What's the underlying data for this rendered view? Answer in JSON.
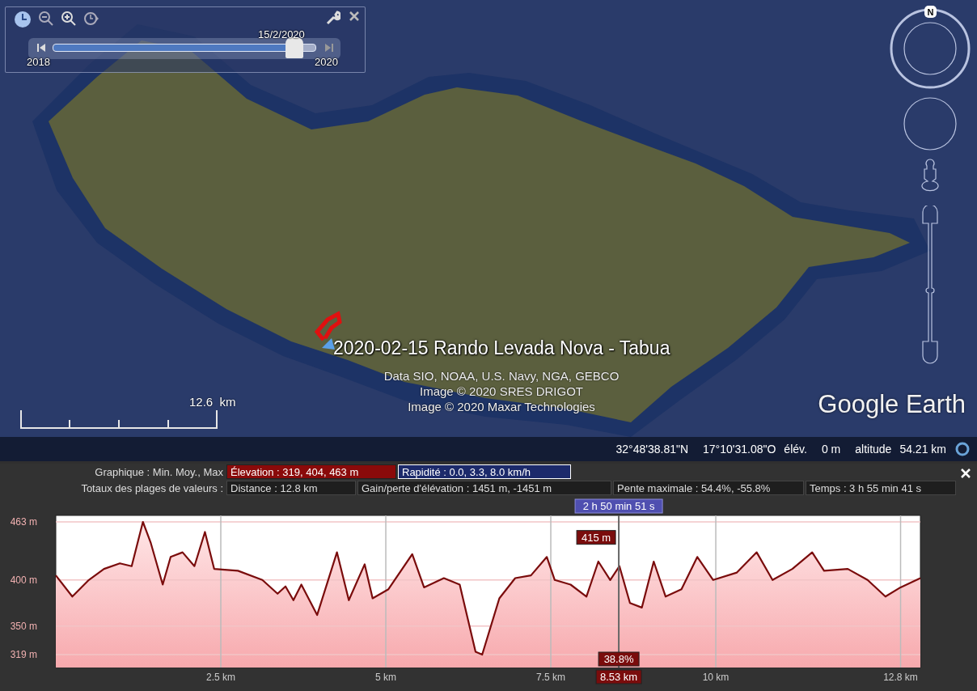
{
  "time_slider": {
    "date_label": "15/2/2020",
    "start_label": "2018",
    "end_label": "2020",
    "level": 0.95
  },
  "compass": {
    "north_label": "N"
  },
  "track_label": "2020-02-15 Rando Levada Nova - Tabua",
  "credits": [
    "Data SIO, NOAA, U.S. Navy, NGA, GEBCO",
    "Image © 2020 SRES DRIGOT",
    "Image © 2020 Maxar Technologies"
  ],
  "scale": {
    "value": "12.6",
    "unit": "km"
  },
  "logo": "Google Earth",
  "status_bar": {
    "latitude": "32°48'38.81\"N",
    "longitude": "17°10'31.08\"O",
    "elevation_label": "élév.",
    "elevation": "0 m",
    "altitude_label": "altitude",
    "altitude": "54.21 km"
  },
  "profile": {
    "graph_label": "Graphique : Min. Moy., Max",
    "graph_series": [
      {
        "label": "Élevation : 319, 404, 463 m",
        "color": "#8a0a0a"
      },
      {
        "label": "Rapidité : 0.0, 3.3, 8.0 km/h",
        "color": "#1c2a6b"
      }
    ],
    "totals_label": "Totaux des plages de valeurs :",
    "totals": [
      "Distance : 12.8 km",
      "Gain/perte d'élévation : 1451 m, -1451 m",
      "Pente maximale : 54.4%, -55.8%",
      "Temps : 3 h 55 min 41 s"
    ],
    "cursor": {
      "time": "2 h 50 min 51 s",
      "elevation": "415 m",
      "slope": "38.8%",
      "distance": "8.53 km"
    },
    "chart_data": {
      "type": "area",
      "grid": true,
      "xlim": [
        0,
        13.1
      ],
      "ylim": [
        305,
        470
      ],
      "xticks": [
        {
          "value": 2.5,
          "label": "2.5 km"
        },
        {
          "value": 5,
          "label": "5 km"
        },
        {
          "value": 7.5,
          "label": "7.5 km"
        },
        {
          "value": 10,
          "label": "10 km"
        },
        {
          "value": 12.8,
          "label": "12.8 km"
        }
      ],
      "yticks": [
        {
          "value": 463,
          "label": "463 m"
        },
        {
          "value": 400,
          "label": "400 m"
        },
        {
          "value": 350,
          "label": "350 m"
        },
        {
          "value": 319,
          "label": "319 m"
        }
      ],
      "x": [
        0,
        0.25,
        0.5,
        0.73,
        0.97,
        1.15,
        1.32,
        1.44,
        1.62,
        1.74,
        1.92,
        2.1,
        2.26,
        2.4,
        2.76,
        3.13,
        3.36,
        3.48,
        3.6,
        3.72,
        3.96,
        4.26,
        4.44,
        4.68,
        4.8,
        5.04,
        5.4,
        5.58,
        5.88,
        6.12,
        6.36,
        6.46,
        6.72,
        6.96,
        7.2,
        7.44,
        7.56,
        7.8,
        8.04,
        8.22,
        8.4,
        8.54,
        8.7,
        8.88,
        9.06,
        9.24,
        9.48,
        9.72,
        9.96,
        10.32,
        10.62,
        10.86,
        11.16,
        11.46,
        11.64,
        12.0,
        12.3,
        12.57,
        12.8,
        13.1
      ],
      "series": [
        {
          "color": "#7a0c0c",
          "values": [
            405,
            382,
            400,
            412,
            418,
            415,
            463,
            440,
            395,
            425,
            430,
            415,
            452,
            412,
            410,
            400,
            385,
            393,
            378,
            395,
            362,
            430,
            378,
            417,
            380,
            390,
            428,
            392,
            402,
            395,
            322,
            319,
            380,
            402,
            405,
            425,
            400,
            395,
            382,
            420,
            400,
            415,
            375,
            370,
            420,
            382,
            390,
            425,
            400,
            408,
            430,
            400,
            412,
            430,
            410,
            412,
            400,
            382,
            392,
            402
          ]
        }
      ],
      "ref_lines": [
        {
          "axis": "x",
          "value": 8.53
        }
      ]
    }
  }
}
